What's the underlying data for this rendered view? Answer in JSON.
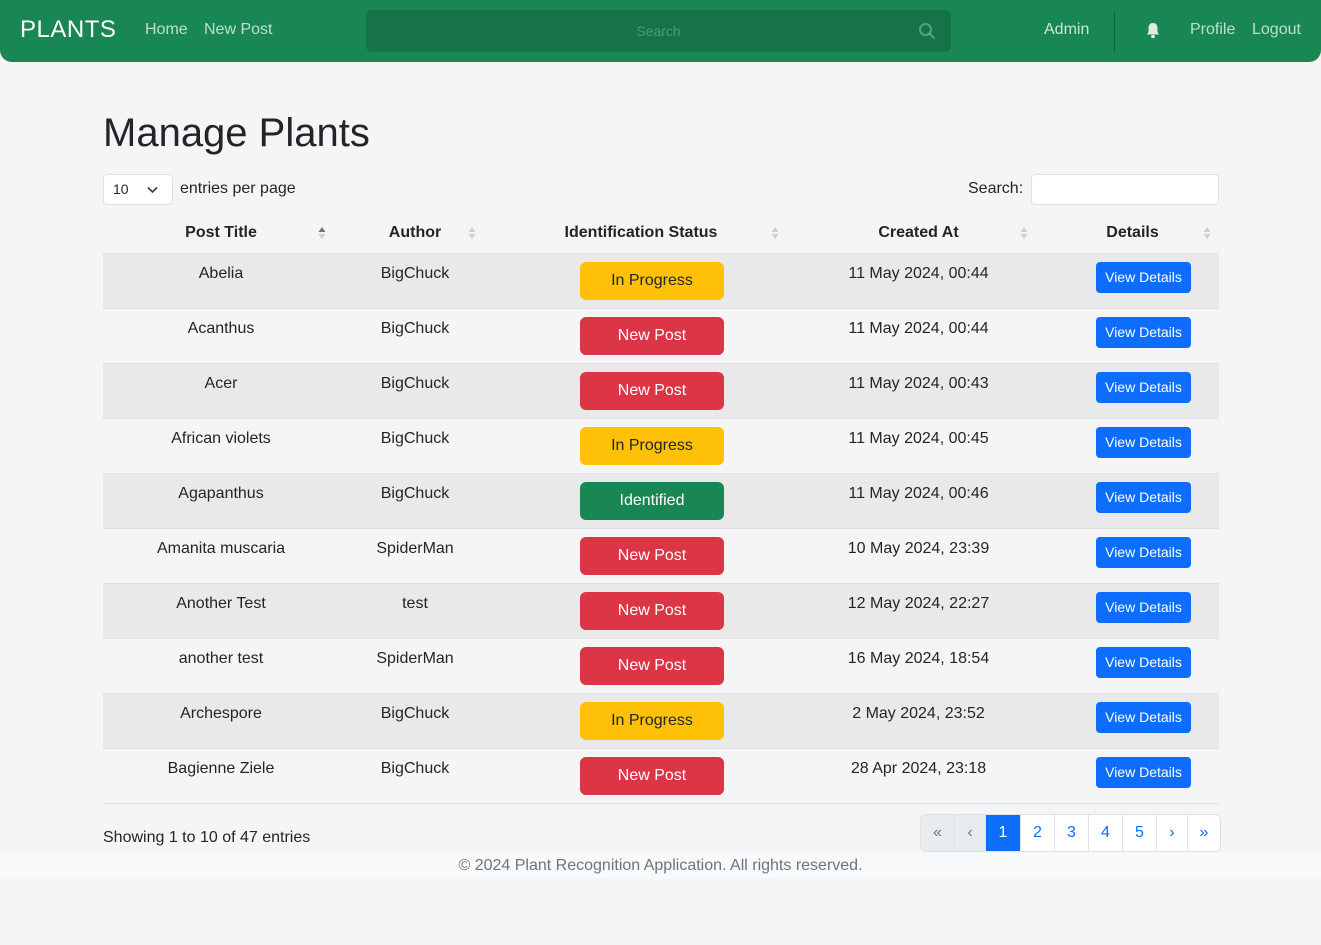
{
  "nav": {
    "brand": "PLANTS",
    "home": "Home",
    "new_post": "New Post",
    "search_placeholder": "Search",
    "admin": "Admin",
    "profile": "Profile",
    "logout": "Logout"
  },
  "page": {
    "title": "Manage Plants",
    "entries_value": "10",
    "entries_label": "entries per page",
    "search_label": "Search:"
  },
  "table": {
    "headers": [
      "Post Title",
      "Author",
      "Identification Status",
      "Created At",
      "Details"
    ],
    "rows": [
      {
        "title": "Abelia",
        "author": "BigChuck",
        "status": "In Progress",
        "created": "11 May 2024, 00:44",
        "details": "View Details"
      },
      {
        "title": "Acanthus",
        "author": "BigChuck",
        "status": "New Post",
        "created": "11 May 2024, 00:44",
        "details": "View Details"
      },
      {
        "title": "Acer",
        "author": "BigChuck",
        "status": "New Post",
        "created": "11 May 2024, 00:43",
        "details": "View Details"
      },
      {
        "title": "African violets",
        "author": "BigChuck",
        "status": "In Progress",
        "created": "11 May 2024, 00:45",
        "details": "View Details"
      },
      {
        "title": "Agapanthus",
        "author": "BigChuck",
        "status": "Identified",
        "created": "11 May 2024, 00:46",
        "details": "View Details"
      },
      {
        "title": "Amanita muscaria",
        "author": "SpiderMan",
        "status": "New Post",
        "created": "10 May 2024, 23:39",
        "details": "View Details"
      },
      {
        "title": "Another Test",
        "author": "test",
        "status": "New Post",
        "created": "12 May 2024, 22:27",
        "details": "View Details"
      },
      {
        "title": "another test",
        "author": "SpiderMan",
        "status": "New Post",
        "created": "16 May 2024, 18:54",
        "details": "View Details"
      },
      {
        "title": "Archespore",
        "author": "BigChuck",
        "status": "In Progress",
        "created": "2 May 2024, 23:52",
        "details": "View Details"
      },
      {
        "title": "Bagienne Ziele",
        "author": "BigChuck",
        "status": "New Post",
        "created": "28 Apr 2024, 23:18",
        "details": "View Details"
      }
    ]
  },
  "pagination": {
    "showing": "Showing 1 to 10 of 47 entries",
    "first": "«",
    "prev": "‹",
    "pages": [
      "1",
      "2",
      "3",
      "4",
      "5"
    ],
    "next": "›",
    "last": "»",
    "current": "1"
  },
  "footer": {
    "text": "© 2024 Plant Recognition Application. All rights reserved."
  },
  "colors": {
    "navbar": "#198754",
    "in_progress": "#ffc107",
    "new_post": "#dc3545",
    "identified": "#198754",
    "primary": "#0d6efd"
  }
}
